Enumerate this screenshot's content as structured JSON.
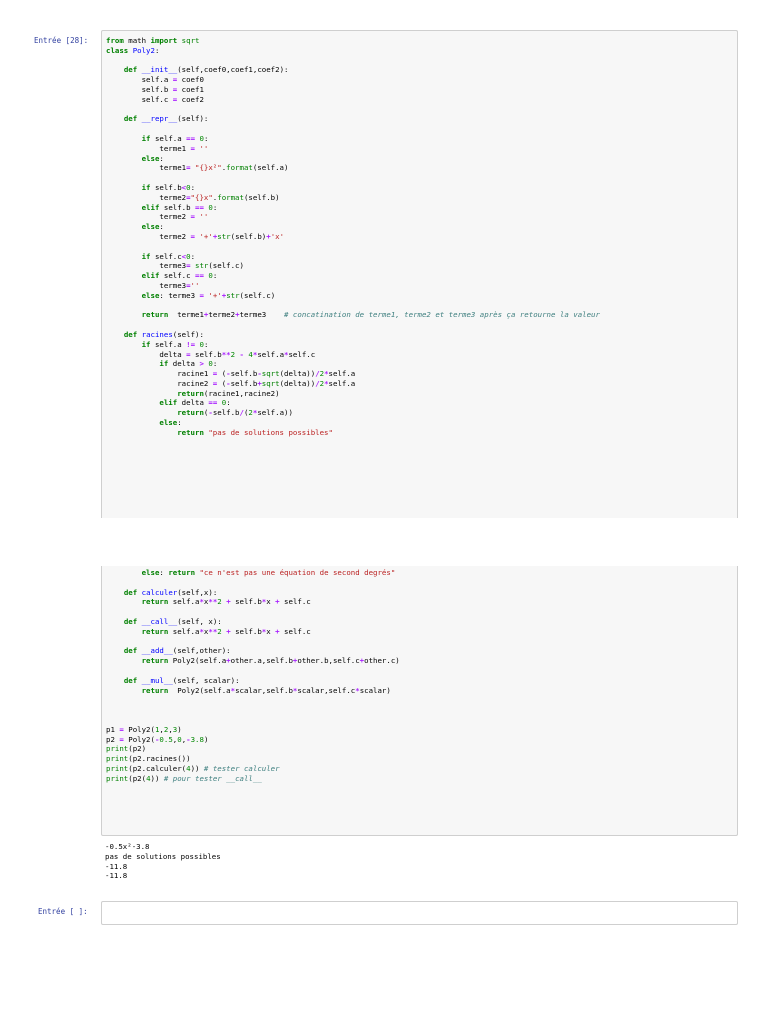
{
  "cell1": {
    "prompt": "Entrée [28]:",
    "lines_part1": [
      "from math import sqrt",
      "class Poly2:",
      "",
      "    def __init__(self,coef0,coef1,coef2):",
      "        self.a = coef0",
      "        self.b = coef1",
      "        self.c = coef2",
      "",
      "    def __repr__(self):",
      "",
      "        if self.a == 0:",
      "            terme1 = ''",
      "        else:",
      "            terme1= \"{}x²\".format(self.a)",
      "",
      "        if self.b<0:",
      "            terme2=\"{}x\".format(self.b)",
      "        elif self.b == 0:",
      "            terme2 = ''",
      "        else:",
      "            terme2 = '+'+str(self.b)+'x'",
      "",
      "        if self.c<0:",
      "            terme3= str(self.c)",
      "        elif self.c == 0:",
      "            terme3=''",
      "        else: terme3 = '+'+str(self.c)",
      "",
      "        return  terme1+terme2+terme3    # concatination de terme1, terme2 et terme3 après ça retourne la valeur",
      "",
      "    def racines(self):",
      "        if self.a != 0:",
      "            delta = self.b**2 - 4*self.a*self.c",
      "            if delta > 0:",
      "                racine1 = (-self.b-sqrt(delta))/2*self.a",
      "                racine2 = (-self.b+sqrt(delta))/2*self.a",
      "                return(racine1,racine2)",
      "            elif delta == 0:",
      "                return(-self.b/(2*self.a))",
      "            else:",
      "                return \"pas de solutions possibles\""
    ],
    "lines_part2": [
      "        else: return \"ce n'est pas une équation de second degrés\"",
      "",
      "    def calculer(self,x):",
      "        return self.a*x**2 + self.b*x + self.c",
      "",
      "    def __call__(self, x):",
      "        return self.a*x**2 + self.b*x + self.c",
      "",
      "    def __add__(self,other):",
      "        return Poly2(self.a+other.a,self.b+other.b,self.c+other.c)",
      "",
      "    def __mul__(self, scalar):",
      "        return  Poly2(self.a*scalar,self.b*scalar,self.c*scalar)",
      "",
      "",
      "",
      "p1 = Poly2(1,2,3)",
      "p2 = Poly2(-0.5,0,-3.8)",
      "print(p2)",
      "print(p2.racines())",
      "print(p2.calculer(4)) # tester calculer",
      "print(p2(4)) # pour tester __call__"
    ],
    "output": [
      "-0.5x²-3.8",
      "pas de solutions possibles",
      "-11.8",
      "-11.8"
    ]
  },
  "cell2": {
    "prompt": "Entrée [ ]:",
    "value": ""
  }
}
